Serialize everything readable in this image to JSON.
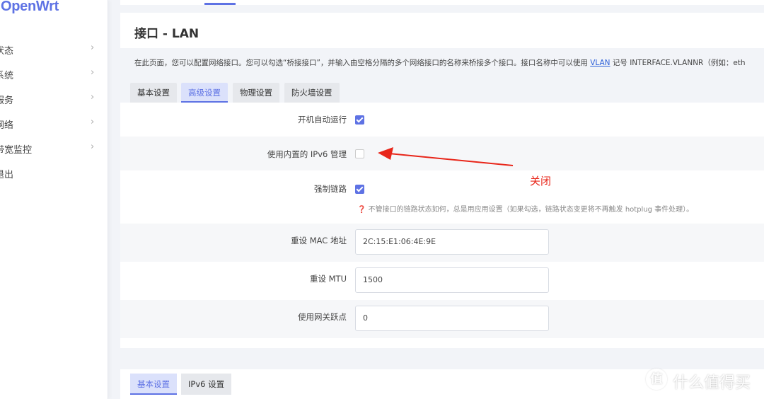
{
  "app": {
    "logo_text": "OpenWrt",
    "accent_color": "#5e72e4"
  },
  "sidebar": {
    "items": [
      {
        "label": "状态",
        "icon": "chevron-right-icon"
      },
      {
        "label": "系统",
        "icon": "chevron-right-icon"
      },
      {
        "label": "服务",
        "icon": "chevron-right-icon"
      },
      {
        "label": "网络",
        "icon": "chevron-right-icon"
      },
      {
        "label": "带宽监控",
        "icon": "chevron-right-icon"
      },
      {
        "label": "退出"
      }
    ]
  },
  "header": {
    "title": "接口 - LAN",
    "description_before": "在此页面，您可以配置网络接口。您可以勾选“桥接接口”，并输入由空格分隔的多个网络接口的名称来桥接多个接口。接口名称中可以使用 ",
    "description_link": "VLAN",
    "description_after": " 记号 INTERFACE.VLANNR（例如：eth"
  },
  "tabs": [
    {
      "label": "基本设置",
      "active": false
    },
    {
      "label": "高级设置",
      "active": true
    },
    {
      "label": "物理设置",
      "active": false
    },
    {
      "label": "防火墙设置",
      "active": false
    }
  ],
  "settings": {
    "auto_start": {
      "label": "开机自动运行",
      "checked": true
    },
    "builtin_ipv6": {
      "label": "使用内置的 IPv6 管理",
      "checked": false
    },
    "force_link": {
      "label": "强制链路",
      "checked": true,
      "hint": "不管接口的链路状态如何，总是用应用设置（如果勾选，链路状态变更将不再触发 hotplug 事件处理）。",
      "hint_icon": "question-circle-icon"
    },
    "override_mac": {
      "label": "重设 MAC 地址",
      "value": "2C:15:E1:06:4E:9E"
    },
    "override_mtu": {
      "label": "重设 MTU",
      "value": "1500"
    },
    "gateway_metric": {
      "label": "使用网关跃点",
      "value": "0"
    }
  },
  "annotation": {
    "text": "关闭",
    "color": "#e8261a"
  },
  "bottom_tabs": [
    {
      "label": "基本设置",
      "active": true
    },
    {
      "label": "IPv6 设置",
      "active": false
    }
  ],
  "watermark": {
    "badge": "值",
    "text": "什么值得买"
  }
}
